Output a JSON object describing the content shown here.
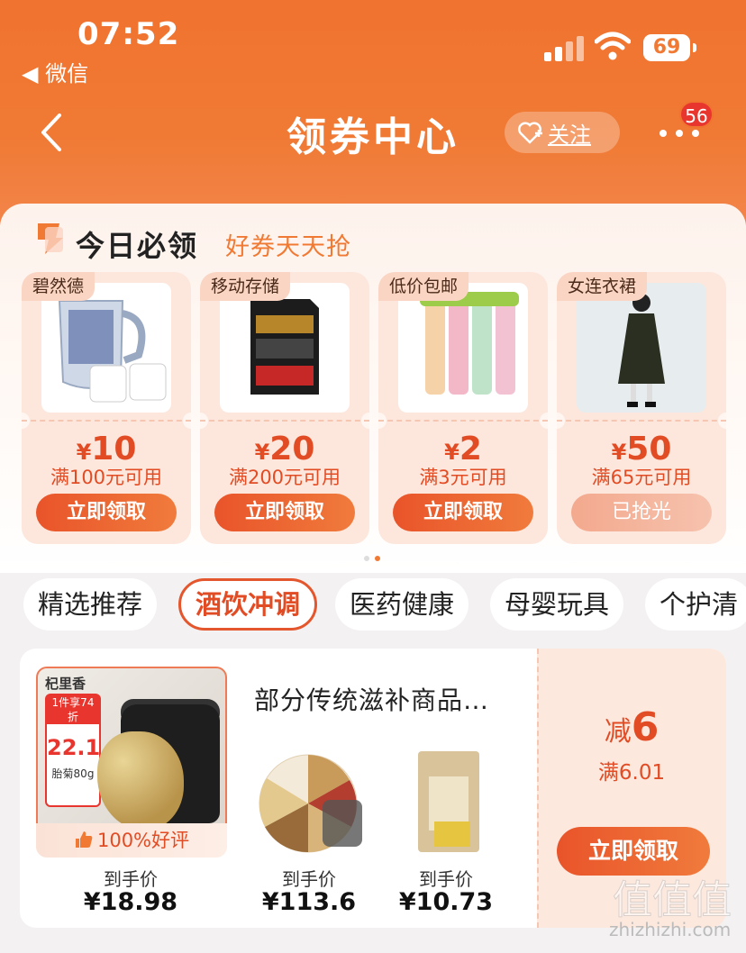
{
  "status_bar": {
    "time": "07:52",
    "back_app": "◀ 微信",
    "battery": "69"
  },
  "nav": {
    "title": "领券中心",
    "follow_label": "关注",
    "more_badge": "56"
  },
  "today": {
    "title": "今日必领",
    "subtitle": "好券天天抢"
  },
  "coupons": [
    {
      "tag": "碧然德",
      "currency": "¥",
      "amount": "10",
      "condition": "满100元可用",
      "button": "立即领取"
    },
    {
      "tag": "移动存储",
      "currency": "¥",
      "amount": "20",
      "condition": "满200元可用",
      "button": "立即领取"
    },
    {
      "tag": "低价包邮",
      "currency": "¥",
      "amount": "2",
      "condition": "满3元可用",
      "button": "立即领取"
    },
    {
      "tag": "女连衣裙",
      "currency": "¥",
      "amount": "50",
      "condition": "满65元可用",
      "button": "已抢光"
    }
  ],
  "categories": [
    "精选推荐",
    "酒饮冲调",
    "医药健康",
    "母婴玩具",
    "个护清"
  ],
  "product_card": {
    "title": "部分传统滋补商品…",
    "main_image": {
      "brand": "杞里香",
      "promo_top": "1件享74折",
      "promo_price": "22.1",
      "promo_name": "胎菊80g",
      "rating": "100%好评"
    },
    "items": [
      {
        "label": "到手价",
        "price": "¥18.98"
      },
      {
        "label": "到手价",
        "price": "¥113.6"
      },
      {
        "label": "到手价",
        "price": "¥10.73"
      }
    ],
    "coupon": {
      "prefix": "减",
      "amount": "6",
      "condition": "满6.01",
      "button": "立即领取"
    }
  },
  "watermark": {
    "text": "zhizhizhi.com",
    "logo": "值值值"
  },
  "colors": {
    "brand_orange": "#f07a34",
    "price_red": "#e24c25",
    "badge_red": "#e8362f"
  }
}
